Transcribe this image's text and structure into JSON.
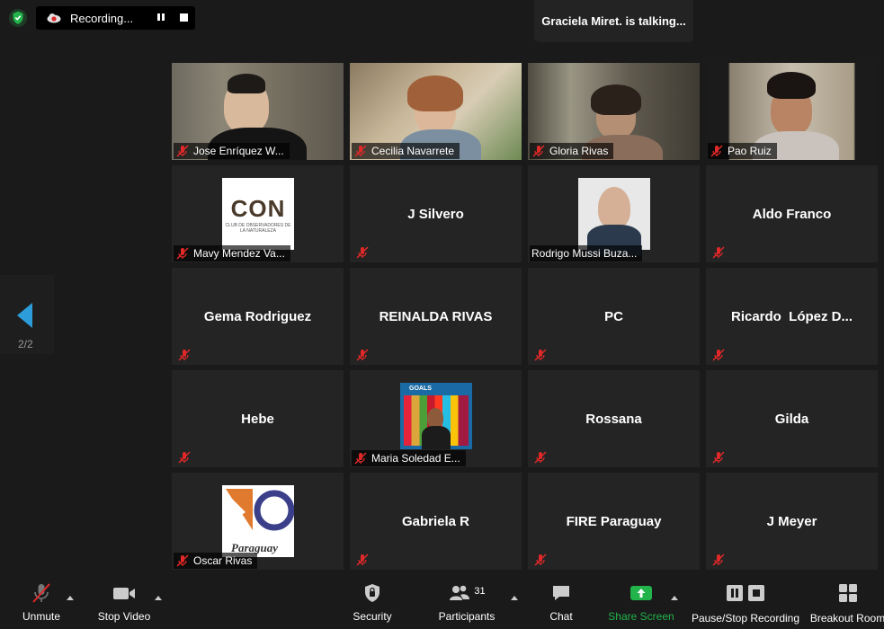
{
  "recording": {
    "status_label": "Recording...",
    "pause_icon": "pause-icon",
    "stop_icon": "stop-icon"
  },
  "speaker": {
    "talking_text": "Graciela Miret. is talking..."
  },
  "pager": {
    "page_label": "2/2"
  },
  "participants": [
    {
      "tag": "Jose Enríquez W..."
    },
    {
      "tag": "Cecilia Navarrete"
    },
    {
      "tag": "Gloria Rivas"
    },
    {
      "tag": "Pao Ruiz"
    },
    {
      "tag": "Mavy Mendez Va...",
      "logo_text": "CON",
      "logo_sub": "CLUB DE OBSERVADORES DE LA NATURALEZA"
    },
    {
      "center": "J Silvero"
    },
    {
      "tag": "Rodrigo Mussi Buza..."
    },
    {
      "center": "Aldo Franco"
    },
    {
      "center": "Gema Rodriguez"
    },
    {
      "center": "REINALDA RIVAS"
    },
    {
      "center": "PC"
    },
    {
      "center": "Ricardo  López D..."
    },
    {
      "center": "Hebe"
    },
    {
      "tag": "Maria Soledad E...",
      "logo_text": "GOALS"
    },
    {
      "center": "Rossana"
    },
    {
      "center": "Gilda"
    },
    {
      "tag": "Oscar Rivas",
      "logo_text": "Paraguay"
    },
    {
      "center": "Gabriela R"
    },
    {
      "center": "FIRE Paraguay"
    },
    {
      "center": "J Meyer"
    }
  ],
  "toolbar": {
    "unmute": "Unmute",
    "stop_video": "Stop Video",
    "security": "Security",
    "participants": "Participants",
    "participants_count": "31",
    "chat": "Chat",
    "share_screen": "Share Screen",
    "pause_stop_recording": "Pause/Stop Recording",
    "breakout_rooms": "Breakout Room"
  },
  "colors": {
    "background": "#1a1a1a",
    "tile": "#242424",
    "muted_red": "#e02828",
    "share_green": "#22b34a",
    "pager_blue": "#2d9cdb",
    "shield_green": "#22b34a"
  }
}
